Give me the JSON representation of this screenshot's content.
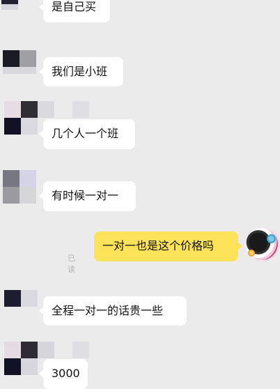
{
  "messages": [
    {
      "side": "left",
      "text": "是自己买"
    },
    {
      "side": "left",
      "text": "我们是小班"
    },
    {
      "side": "left",
      "text": "几个人一个班"
    },
    {
      "side": "left",
      "text": "有时候一对一"
    },
    {
      "side": "right",
      "text": "一对一也是这个价格吗",
      "status": "已读"
    },
    {
      "side": "left",
      "text": "全程一对一的话贵一些"
    },
    {
      "side": "left",
      "text": "3000"
    }
  ]
}
